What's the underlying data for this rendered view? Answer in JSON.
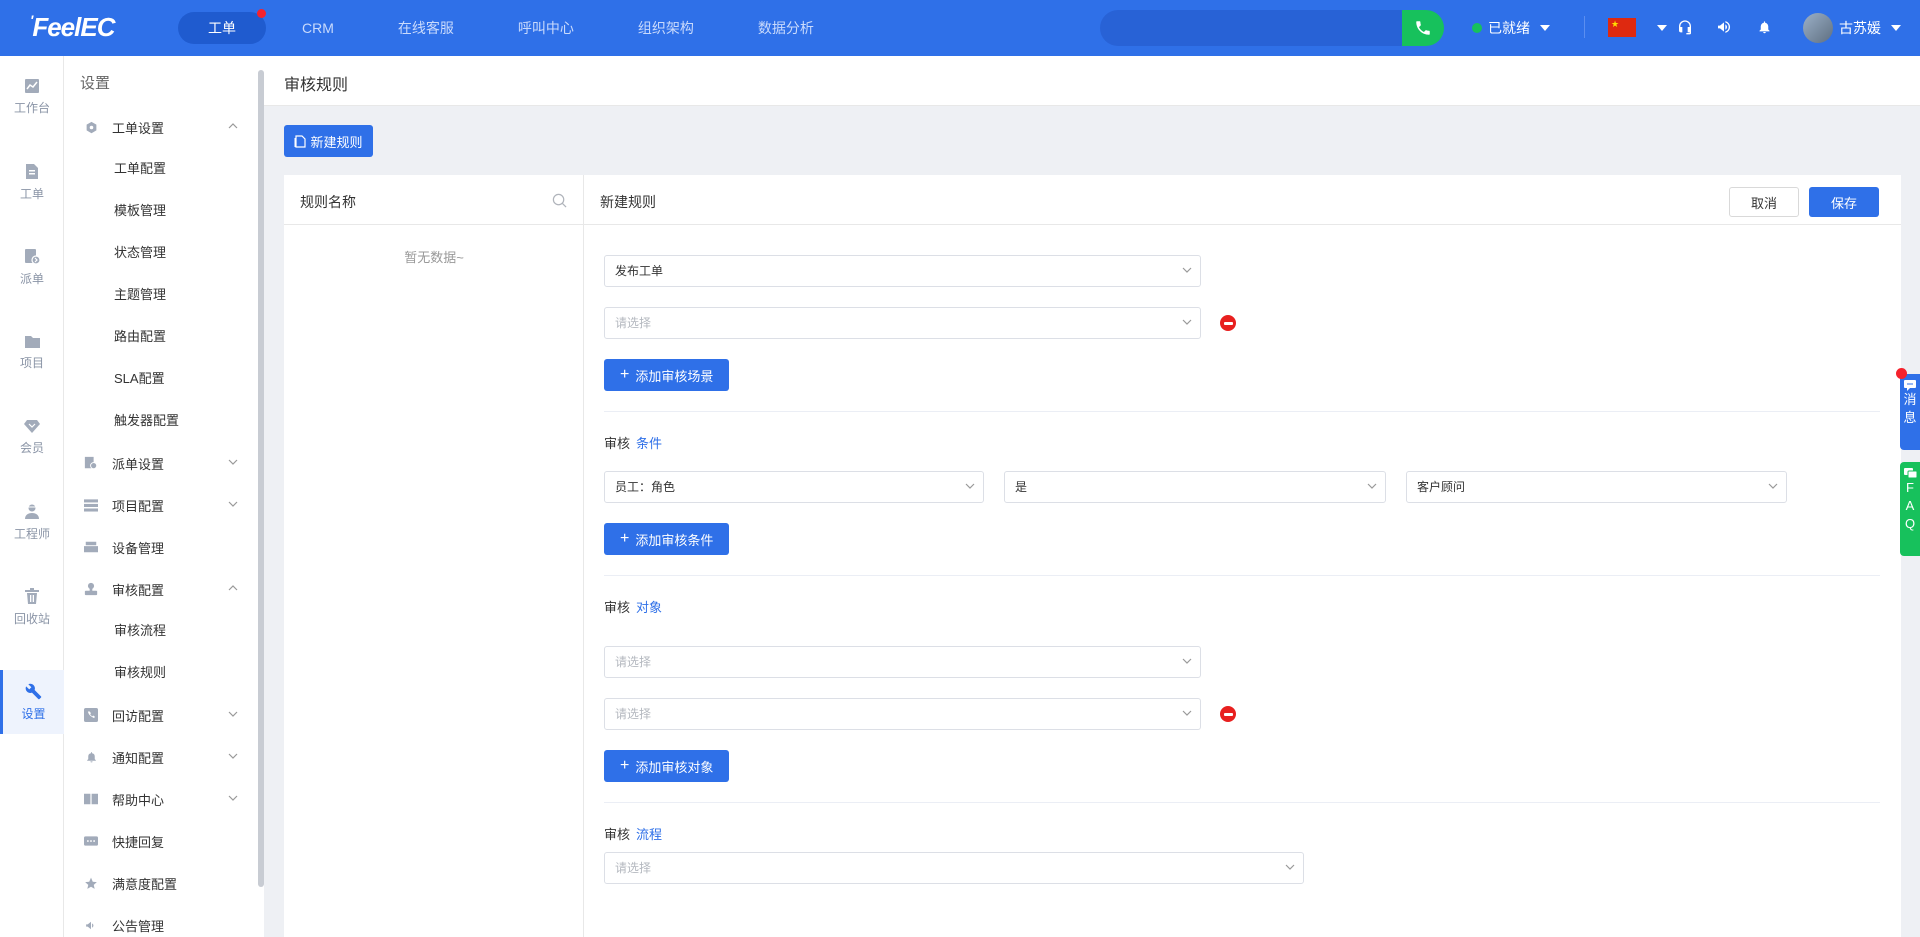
{
  "app": {
    "logo": "FeelEC",
    "logo_mark": "'"
  },
  "topnav": {
    "tabs": [
      {
        "label": "工单",
        "active": true,
        "has_badge": true
      },
      {
        "label": "CRM"
      },
      {
        "label": "在线客服"
      },
      {
        "label": "呼叫中心"
      },
      {
        "label": "组织架构"
      },
      {
        "label": "数据分析"
      }
    ],
    "status": "已就绪",
    "user_name": "古苏媛",
    "flag_stars": "★"
  },
  "rail": {
    "items": [
      {
        "label": "工作台",
        "icon": "chart-icon"
      },
      {
        "label": "工单",
        "icon": "document-icon"
      },
      {
        "label": "派单",
        "icon": "dispatch-icon"
      },
      {
        "label": "项目",
        "icon": "folder-icon"
      },
      {
        "label": "会员",
        "icon": "diamond-icon"
      },
      {
        "label": "工程师",
        "icon": "engineer-icon"
      },
      {
        "label": "回收站",
        "icon": "trash-icon"
      },
      {
        "label": "设置",
        "icon": "wrench-icon",
        "active": true
      }
    ]
  },
  "sidebar": {
    "title": "设置",
    "groups": [
      {
        "label": "工单设置",
        "icon": "gear-icon",
        "expanded": true
      },
      {
        "label": "派单设置",
        "icon": "dispatch-icon"
      },
      {
        "label": "项目配置",
        "icon": "list-icon"
      },
      {
        "label": "设备管理",
        "icon": "device-icon"
      },
      {
        "label": "审核配置",
        "icon": "stamp-icon",
        "expanded": true
      },
      {
        "label": "回访配置",
        "icon": "phone-icon"
      },
      {
        "label": "通知配置",
        "icon": "bell-icon"
      },
      {
        "label": "帮助中心",
        "icon": "book-icon"
      },
      {
        "label": "快捷回复",
        "icon": "chat-icon"
      },
      {
        "label": "满意度配置",
        "icon": "star-icon"
      },
      {
        "label": "公告管理",
        "icon": "megaphone-icon"
      }
    ],
    "ticket_sub": [
      "工单配置",
      "模板管理",
      "状态管理",
      "主题管理",
      "路由配置",
      "SLA配置",
      "触发器配置"
    ],
    "audit_sub": [
      "审核流程",
      "审核规则"
    ]
  },
  "page": {
    "title": "审核规则",
    "new_rule_label": "新建规则"
  },
  "left_panel": {
    "header": "规则名称",
    "empty": "暂无数据~"
  },
  "right_panel": {
    "header": "新建规则",
    "cancel": "取消",
    "save": "保存",
    "scene": {
      "select1": "发布工单",
      "select2_placeholder": "请选择",
      "add_label": "添加审核场景"
    },
    "condition": {
      "label": "审核",
      "label_hl": "条件",
      "field": "员工：角色",
      "operator": "是",
      "value": "客户顾问",
      "add_label": "添加审核条件"
    },
    "object": {
      "label": "审核",
      "label_hl": "对象",
      "select1_placeholder": "请选择",
      "select2_placeholder": "请选择",
      "add_label": "添加审核对象"
    },
    "flow": {
      "label": "审核",
      "label_hl": "流程",
      "select_placeholder": "请选择"
    }
  },
  "floating": {
    "msg_chars": [
      "消",
      "息"
    ],
    "faq_chars": [
      "F",
      "A",
      "Q"
    ]
  }
}
